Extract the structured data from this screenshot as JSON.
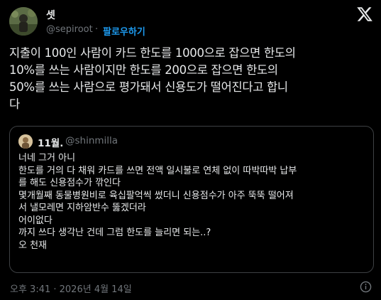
{
  "author": {
    "display_name": "셋",
    "handle": "@sepiroot",
    "separator": "·",
    "follow_label": "팔로우하기"
  },
  "tweet": {
    "text": "지출이 100인 사람이 카드 한도를 1000으로 잡으면 한도의\n10%를 쓰는 사람이지만 한도를 200으로 잡으면 한도의\n50%를 쓰는 사람으로 평가돼서 신용도가 떨어진다고 합니\n다"
  },
  "quote": {
    "display_name": "11월.",
    "handle": "@shinmilla",
    "text": "너네 그거 아니\n한도를 거의 다 채워 카드를 쓰면 전액 일시불로 연체 없이 따박따박 납부\n를 해도  신용점수가 깎인다\n몇개월째 동물병원비로 육십팔억씩 썼더니 신용점수가 아주 뚝뚝 떨어져\n서 낼모레면 지하암반수 뚫겠더라\n어이없다\n까지 쓰다 생각난 건데 그럼 한도를 늘리면 되는..?\n오 천재"
  },
  "meta": {
    "timestamp": "오후 3:41 · 2026년 4월 14일"
  },
  "colors": {
    "background": "#000000",
    "text": "#e7e9ea",
    "secondary": "#71767b",
    "accent": "#1d9bf0",
    "border": "#3e4144"
  },
  "icons": {
    "brand": "x-logo-icon",
    "info": "info-icon"
  }
}
